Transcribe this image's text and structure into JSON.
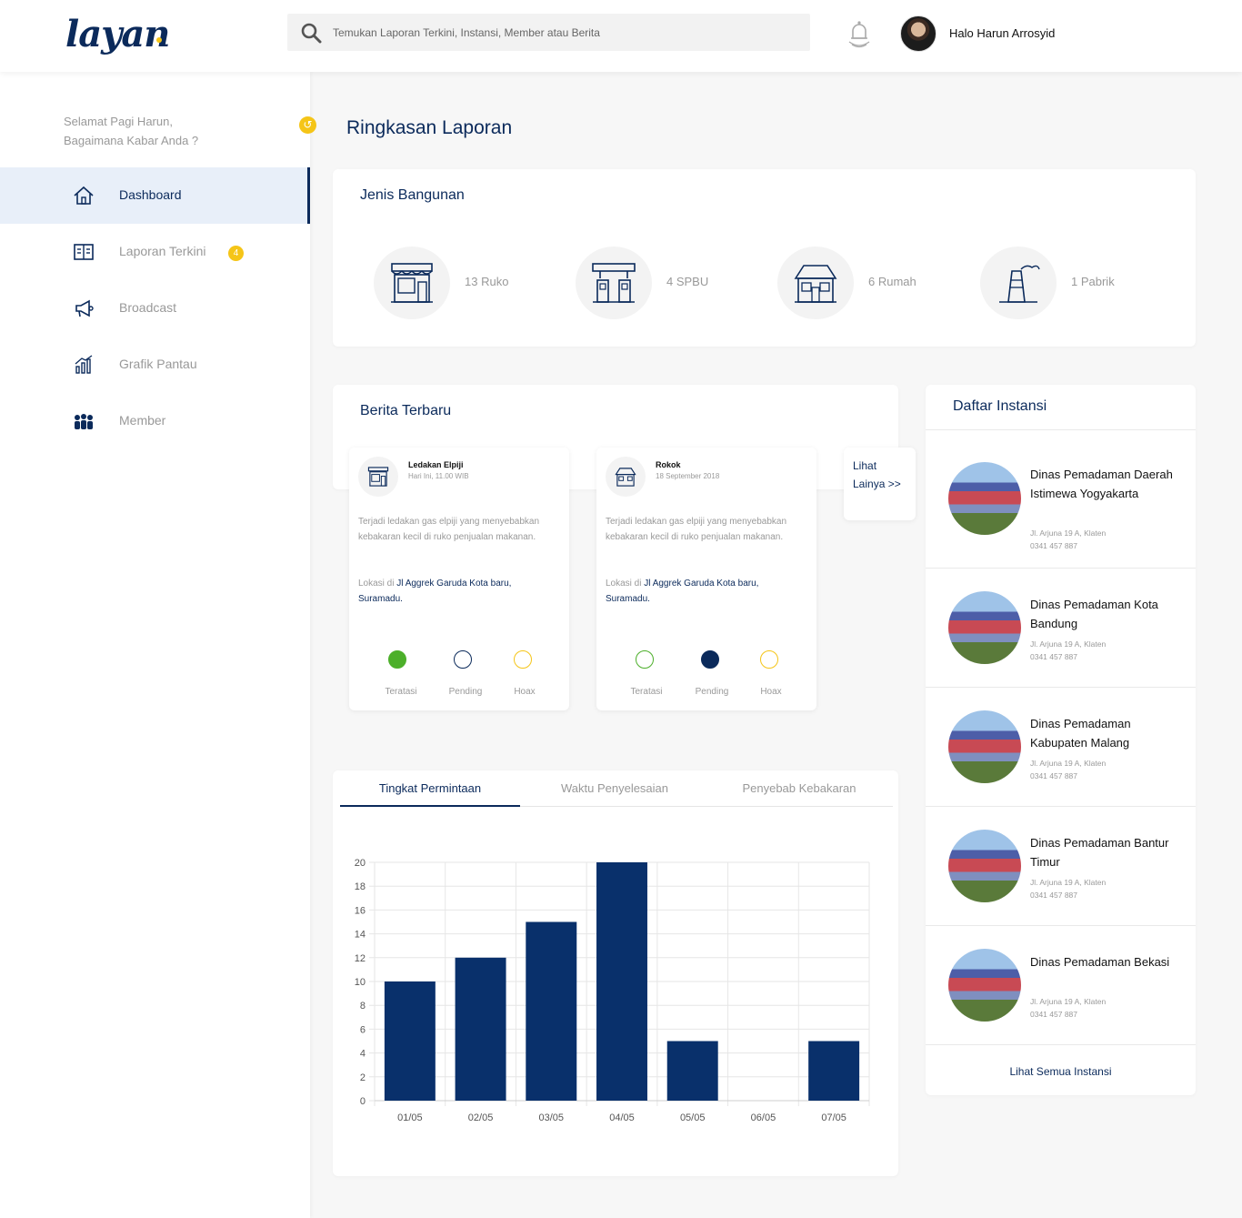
{
  "app": {
    "logo": "layan"
  },
  "header": {
    "search_placeholder": "Temukan Laporan Terkini, Instansi, Member atau Berita",
    "user_greeting": "Halo Harun Arrosyid"
  },
  "sidebar": {
    "welcome_line1": "Selamat Pagi Harun,",
    "welcome_line2": "Bagaimana Kabar Anda ?",
    "items": [
      {
        "label": "Dashboard",
        "icon": "home-icon",
        "active": true
      },
      {
        "label": "Laporan Terkini",
        "icon": "report-icon",
        "badge": "4"
      },
      {
        "label": "Broadcast",
        "icon": "megaphone-icon"
      },
      {
        "label": "Grafik Pantau",
        "icon": "bar-chart-icon"
      },
      {
        "label": "Member",
        "icon": "members-icon"
      }
    ]
  },
  "main": {
    "page_title": "Ringkasan Laporan"
  },
  "jenis_bangunan": {
    "title": "Jenis Bangunan",
    "items": [
      {
        "label": "13 Ruko",
        "icon": "shop-icon"
      },
      {
        "label": "4 SPBU",
        "icon": "gas-station-icon"
      },
      {
        "label": "6 Rumah",
        "icon": "house-icon"
      },
      {
        "label": "1 Pabrik",
        "icon": "factory-icon"
      }
    ]
  },
  "berita": {
    "title": "Berita Terbaru",
    "more": "Lihat Lainya >>",
    "items": [
      {
        "title": "Ledakan Elpiji",
        "time": "Hari Ini, 11.00 WIB",
        "desc": "Terjadi ledakan gas elpiji yang menyebabkan kebakaran kecil di ruko penjualan makanan.",
        "loc_prefix": "Lokasi di",
        "loc": "Jl Aggrek Garuda Kota baru, Suramadu.",
        "status": "Teratasi"
      },
      {
        "title": "Rokok",
        "time": "18 September 2018",
        "desc": "Terjadi ledakan gas elpiji yang menyebabkan kebakaran kecil di ruko penjualan makanan.",
        "loc_prefix": "Lokasi di",
        "loc": "Jl Aggrek Garuda Kota baru, Suramadu.",
        "status": "Pending"
      }
    ],
    "status_labels": [
      "Teratasi",
      "Pending",
      "Hoax"
    ],
    "status_colors": {
      "Teratasi": "#4caf2a",
      "Pending": "#0b2a5b",
      "Hoax": "#f5c518"
    }
  },
  "chart_tabs": [
    "Tingkat Permintaan",
    "Waktu Penyelesaian",
    "Penyebab Kebakaran"
  ],
  "chart_data": {
    "type": "bar",
    "categories": [
      "01/05",
      "02/05",
      "03/05",
      "04/05",
      "05/05",
      "06/05",
      "07/05"
    ],
    "values": [
      10,
      12,
      15,
      20,
      5,
      0,
      5
    ],
    "ylim": [
      0,
      20
    ],
    "yticks": [
      0,
      2,
      4,
      6,
      8,
      10,
      12,
      14,
      16,
      18,
      20
    ],
    "grid": true,
    "color": "#09306b"
  },
  "instansi": {
    "title": "Daftar Instansi",
    "footer": "Lihat Semua Instansi",
    "items": [
      {
        "name": "Dinas Pemadaman Daerah Istimewa Yogyakarta",
        "address": "Jl. Arjuna 19 A, Klaten",
        "phone": "0341 457 887"
      },
      {
        "name": "Dinas Pemadaman Kota Bandung",
        "address": "Jl. Arjuna 19 A, Klaten",
        "phone": "0341 457 887"
      },
      {
        "name": "Dinas Pemadaman Kabupaten Malang",
        "address": "Jl. Arjuna 19 A, Klaten",
        "phone": "0341 457 887"
      },
      {
        "name": "Dinas Pemadaman Bantur Timur",
        "address": "Jl. Arjuna 19 A, Klaten",
        "phone": "0341 457 887"
      },
      {
        "name": "Dinas Pemadaman Bekasi",
        "address": "Jl. Arjuna 19 A, Klaten",
        "phone": "0341 457 887"
      }
    ]
  }
}
